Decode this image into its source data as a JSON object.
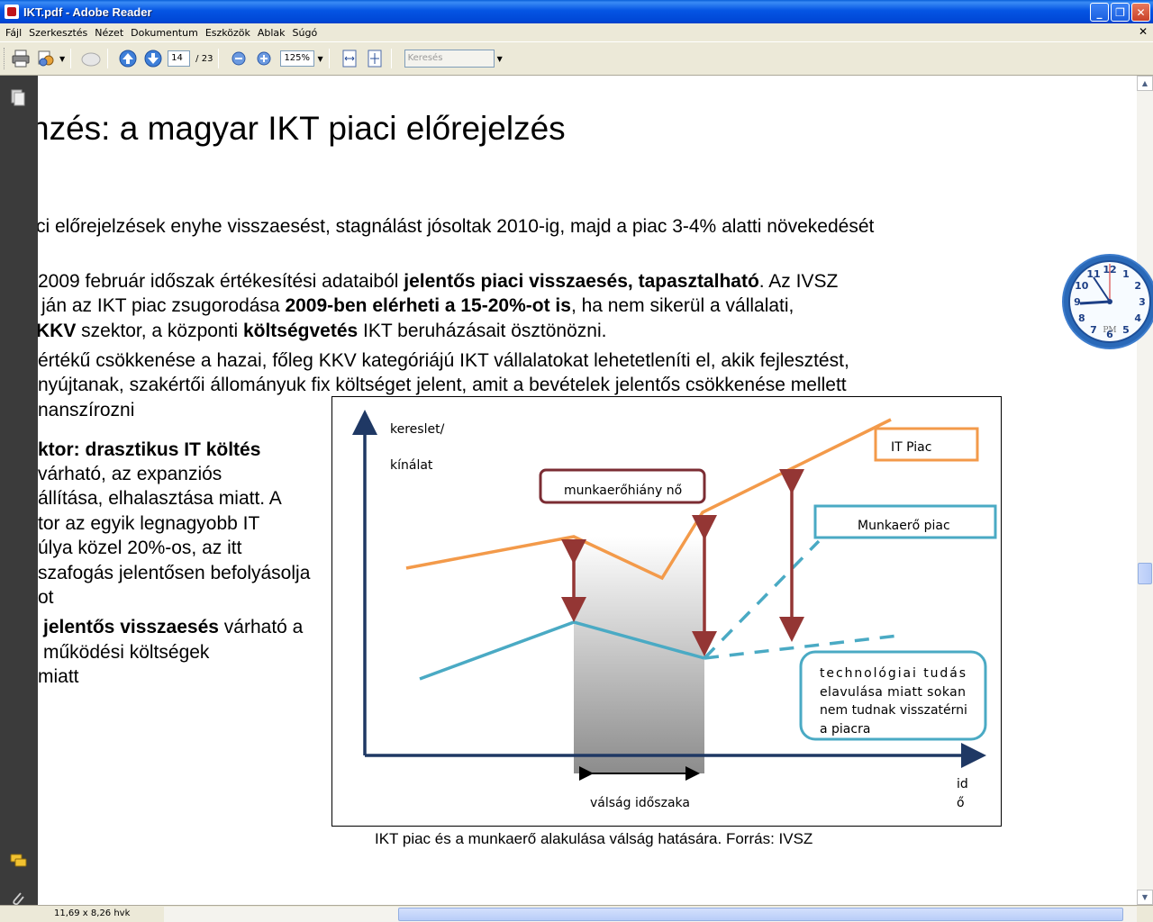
{
  "window": {
    "title": "IKT.pdf - Adobe Reader",
    "minimize": "_",
    "maximize": "❐",
    "close": "✕"
  },
  "menu": {
    "items": [
      "Fájl",
      "Szerkesztés",
      "Nézet",
      "Dokumentum",
      "Eszközök",
      "Ablak",
      "Súgó"
    ],
    "close": "✕"
  },
  "toolbar": {
    "page_current": "14",
    "page_total": "/ 23",
    "zoom": "125%",
    "search_placeholder": "Keresés"
  },
  "document": {
    "title": "nzés: a magyar IKT piaci előrejelzés",
    "lines": [
      "ci előrejelzések enyhe visszaesést, stagnálást jósoltak 2010-ig, majd a piac 3-4% alatti növekedését",
      "2009 február időszak értékesítési adataiból",
      "jelentős piaci visszaesés, tapasztalható",
      ". Az IVSZ",
      "ján az IKT piac zsugorodása",
      "2009-ben elérheti a 15-20%-ot is",
      ", ha nem sikerül a vállalati,",
      "KKV",
      " szektor, a központi ",
      "költségvetés",
      " IKT beruházásait ösztönözni.",
      "értékű csökkenése a hazai, főleg KKV kategóriájú IKT vállalatokat lehetetleníti el, akik fejlesztést,",
      "nyújtanak, szakértői állományuk fix költséget jelent, amit a bevételek jelentős csökkenése mellett",
      "nanszírozni",
      "ktor: drasztikus IT költés",
      "várható, az expanziós",
      "állítása, elhalasztása miatt. A",
      "tor az egyik legnagyobb IT",
      "úlya közel 20%-os, az itt",
      "szafogás jelentősen befolyásolja",
      "ot",
      "jelentős visszaesés",
      " várható a",
      "működési költségek",
      "miatt"
    ],
    "caption": "IKT piac és a munkaerő alakulása válság hatására. Forrás: IVSZ"
  },
  "diagram": {
    "ylabel_line1": "kereslet/",
    "ylabel_line2": "kínálat",
    "xlabel_line1": "id",
    "xlabel_line2": "ő",
    "it_piac": "IT Piac",
    "munkaero_piac": "Munkaerő piac",
    "munkaerohiany": "munkaerőhiány nő",
    "technologiai_line1": "technológiai tudás",
    "technologiai_line2": "elavulása miatt sokan",
    "technologiai_line3": "nem tudnak visszatérni",
    "technologiai_line4": "a piacra",
    "valsag": "válság időszaka",
    "colors": {
      "it": "#f39a4a",
      "labor": "#4aaac4",
      "arrow": "#943634",
      "axis": "#1f3864"
    }
  },
  "statusbar": {
    "dims": "11,69 x 8,26 hvk"
  },
  "clock": {
    "numbers": [
      "12",
      "1",
      "2",
      "3",
      "4",
      "5",
      "6",
      "7",
      "8",
      "9",
      "10",
      "11"
    ],
    "brand": "PM"
  }
}
